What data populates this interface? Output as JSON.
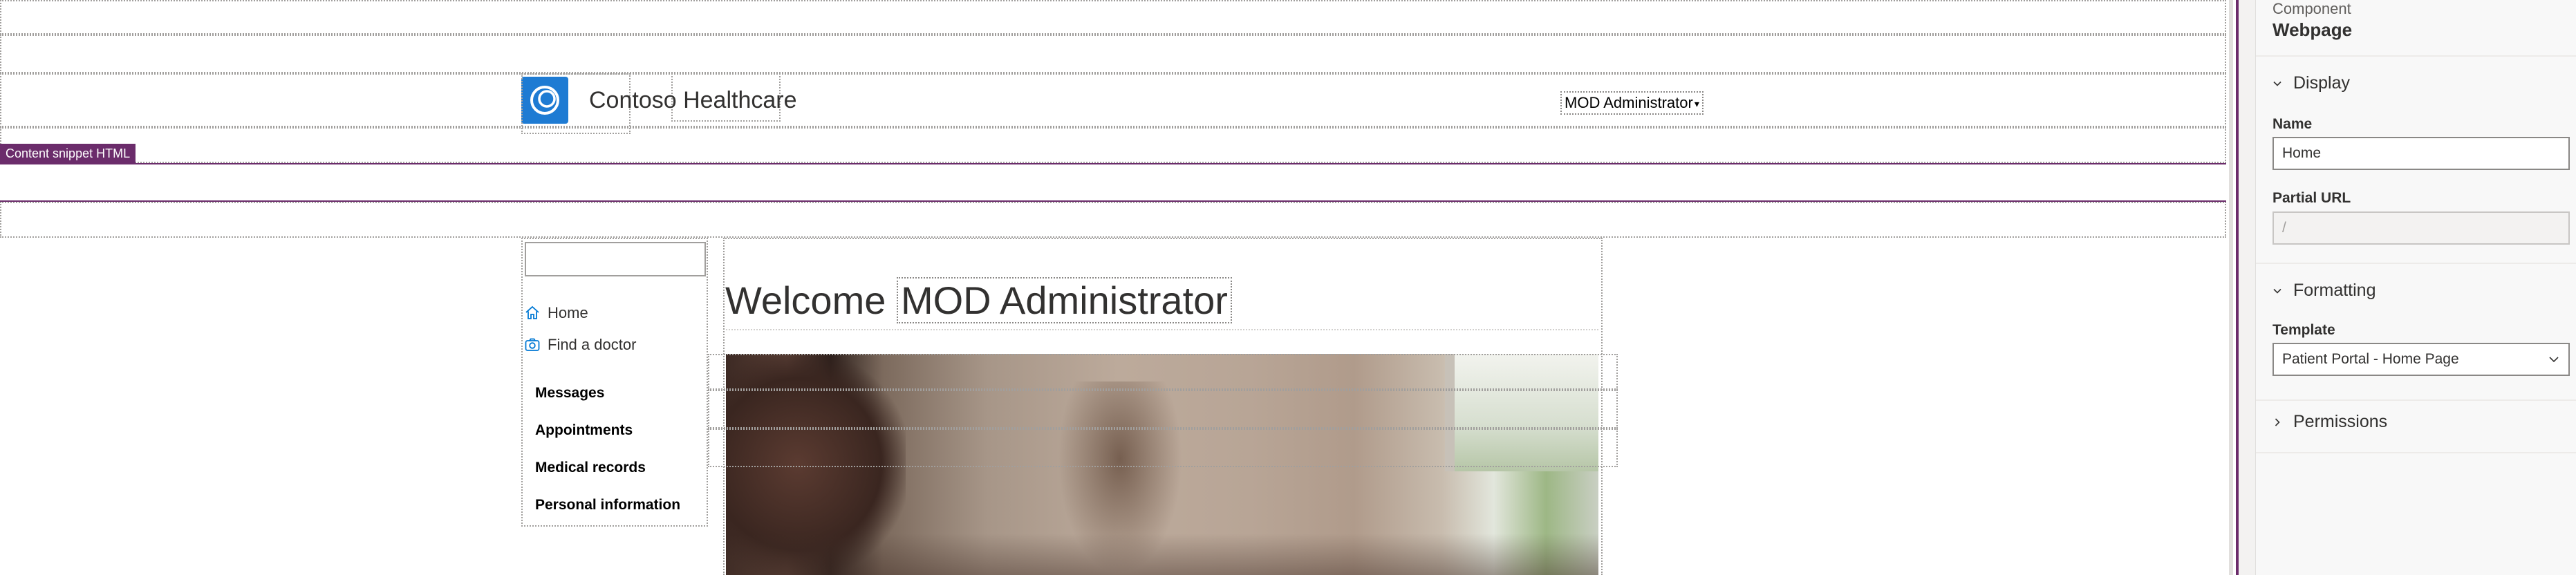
{
  "header": {
    "brand_name": "Contoso Healthcare",
    "user_menu_label": "MOD Administrator",
    "user_menu_caret": "▾"
  },
  "snippet_tag": "Content snippet HTML",
  "sidebar": {
    "links": [
      {
        "label": "Home",
        "icon": "home-icon"
      },
      {
        "label": "Find a doctor",
        "icon": "camera-icon"
      }
    ],
    "sections": [
      "Messages",
      "Appointments",
      "Medical records",
      "Personal information"
    ]
  },
  "main": {
    "welcome_prefix": "Welcome",
    "welcome_name": "MOD Administrator"
  },
  "panel": {
    "kind": "Component",
    "title": "Webpage",
    "display_section": "Display",
    "name_label": "Name",
    "name_value": "Home",
    "partial_url_label": "Partial URL",
    "partial_url_value": "/",
    "formatting_section": "Formatting",
    "template_label": "Template",
    "template_value": "Patient Portal - Home Page",
    "permissions_section": "Permissions"
  },
  "colors": {
    "accent": "#6b2c6b",
    "brand_logo": "#1e7bd3",
    "sidebar_icon": "#0078d4"
  }
}
